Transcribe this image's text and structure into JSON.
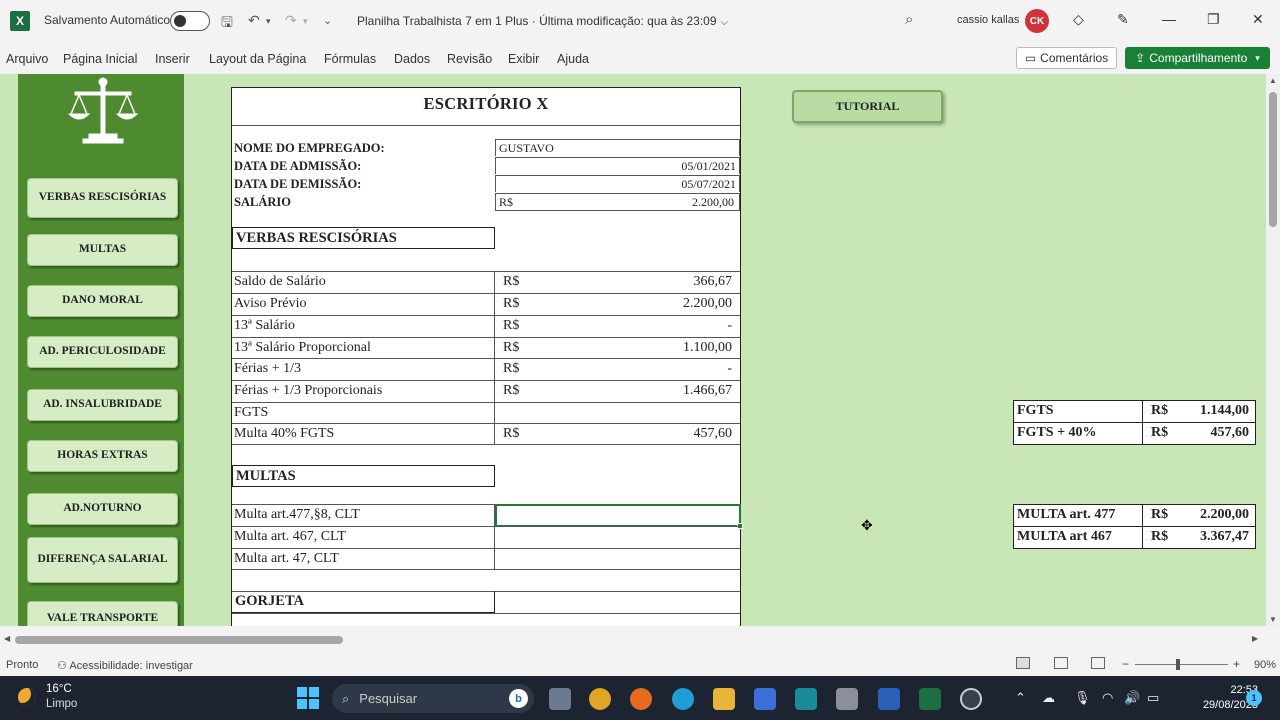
{
  "titlebar": {
    "autosave_label": "Salvamento Automático",
    "doc_title": "Planilha Trabalhista 7 em 1 Plus  ·  Última modificação: qua às 23:09",
    "username": "cassio kallas",
    "avatar_initials": "CK"
  },
  "menu": {
    "items": [
      "Arquivo",
      "Página Inicial",
      "Inserir",
      "Layout da Página",
      "Fórmulas",
      "Dados",
      "Revisão",
      "Exibir",
      "Ajuda"
    ],
    "comments_label": "Comentários",
    "share_label": "Compartilhamento"
  },
  "sidebar": {
    "buttons": [
      "VERBAS RESCISÓRIAS",
      "MULTAS",
      "DANO MORAL",
      "AD. PERICULOSIDADE",
      "AD. INSALUBRIDADE",
      "HORAS EXTRAS",
      "AD.NOTURNO",
      "DIFERENÇA SALARIAL",
      "VALE TRANSPORTE"
    ]
  },
  "form": {
    "title": "ESCRITÓRIO X",
    "employee": {
      "name_label": "NOME DO EMPREGADO:",
      "name_value": "GUSTAVO",
      "admission_label": "DATA DE ADMISSÃO:",
      "admission_value": "05/01/2021",
      "dismissal_label": "DATA DE DEMISSÃO:",
      "dismissal_value": "05/07/2021",
      "salary_label": "SALÁRIO",
      "salary_currency": "R$",
      "salary_value": "2.200,00"
    },
    "verbas_header": "VERBAS RESCISÓRIAS",
    "verbas": [
      {
        "label": "Saldo de Salário",
        "currency": "R$",
        "value": "366,67"
      },
      {
        "label": "Aviso Prévio",
        "currency": "R$",
        "value": "2.200,00"
      },
      {
        "label": "13ª Salário",
        "currency": "R$",
        "value": "-"
      },
      {
        "label": "13ª Salário Proporcional",
        "currency": "R$",
        "value": "1.100,00"
      },
      {
        "label": "Férias + 1/3",
        "currency": "R$",
        "value": "-"
      },
      {
        "label": "Férias + 1/3 Proporcionais",
        "currency": "R$",
        "value": "1.466,67"
      },
      {
        "label": "FGTS",
        "currency": "",
        "value": ""
      },
      {
        "label": "Multa 40% FGTS",
        "currency": "R$",
        "value": "457,60"
      }
    ],
    "multas_header": "MULTAS",
    "multas": [
      {
        "label": "Multa art.477,§8, CLT",
        "currency": "",
        "value": ""
      },
      {
        "label": "Multa art. 467, CLT",
        "currency": "",
        "value": ""
      },
      {
        "label": "Multa art. 47, CLT",
        "currency": "",
        "value": ""
      }
    ],
    "gorjeta_header": "GORJETA"
  },
  "tutorial_label": "TUTORIAL",
  "summary_fgts": [
    {
      "label": "FGTS",
      "currency": "R$",
      "value": "1.144,00"
    },
    {
      "label": "FGTS + 40%",
      "currency": "R$",
      "value": "457,60"
    }
  ],
  "summary_multas": [
    {
      "label": "MULTA art. 477",
      "currency": "R$",
      "value": "2.200,00"
    },
    {
      "label": "MULTA art 467",
      "currency": "R$",
      "value": "3.367,47"
    }
  ],
  "status": {
    "ready": "Pronto",
    "accessibility": "Acessibilidade: investigar",
    "zoom": "90%"
  },
  "taskbar": {
    "temperature": "16°C",
    "weather": "Limpo",
    "search_placeholder": "Pesquisar",
    "time": "22:53",
    "date": "29/08/2023",
    "notifications": "1"
  },
  "colors": {
    "sheet_bg": "#c9e6b6",
    "sidebar_bg": "#4e8a30",
    "button_bg": "#d6ecc5",
    "excel_green": "#1d6f42",
    "share_green": "#1a7f37"
  }
}
